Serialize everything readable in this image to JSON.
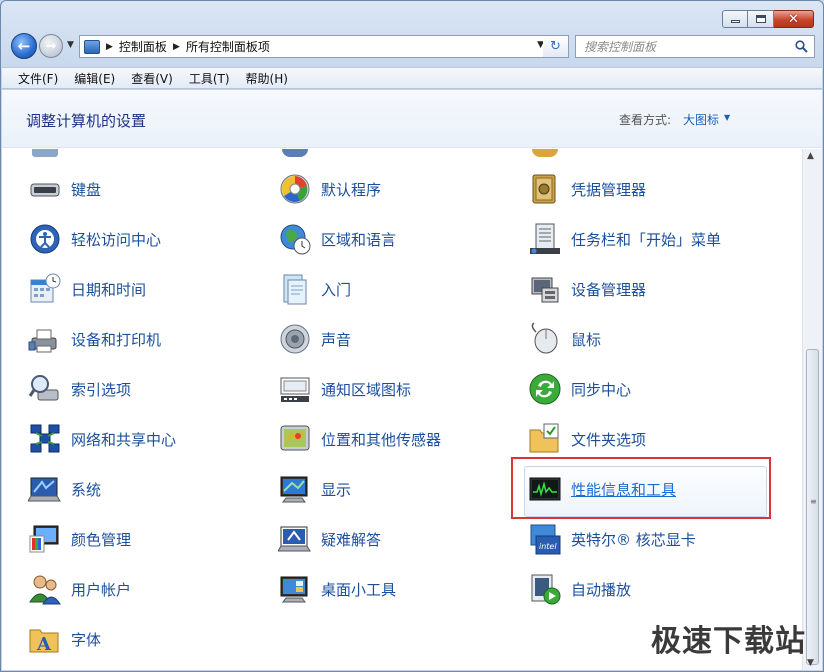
{
  "window": {
    "caption": {
      "minimize": "minimize",
      "maximize": "maximize",
      "close": "close"
    }
  },
  "address": {
    "crumbs": [
      "控制面板",
      "所有控制面板项"
    ]
  },
  "search": {
    "placeholder": "搜索控制面板"
  },
  "menu": [
    "文件(F)",
    "编辑(E)",
    "查看(V)",
    "工具(T)",
    "帮助(H)"
  ],
  "header": {
    "title": "调整计算机的设置",
    "view_by_label": "查看方式:",
    "view_by_value": "大图标"
  },
  "items": {
    "col1": [
      "键盘",
      "轻松访问中心",
      "日期和时间",
      "设备和打印机",
      "索引选项",
      "网络和共享中心",
      "系统",
      "颜色管理",
      "用户帐户",
      "字体"
    ],
    "col2": [
      "默认程序",
      "区域和语言",
      "入门",
      "声音",
      "通知区域图标",
      "位置和其他传感器",
      "显示",
      "疑难解答",
      "桌面小工具"
    ],
    "col3": [
      "凭据管理器",
      "任务栏和「开始」菜单",
      "设备管理器",
      "鼠标",
      "同步中心",
      "文件夹选项",
      "性能信息和工具",
      "英特尔® 核芯显卡",
      "自动播放"
    ]
  },
  "selected_item": "性能信息和工具",
  "watermark": "极速下载站",
  "colors": {
    "link": "#1b4f9c",
    "title": "#1e3287",
    "highlight_frame": "#d83535"
  }
}
